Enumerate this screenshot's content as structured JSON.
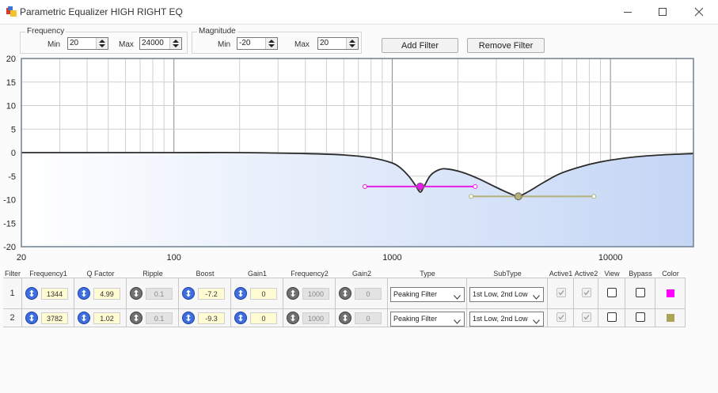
{
  "window": {
    "title": "Parametric Equalizer HIGH RIGHT EQ",
    "controls": [
      "minimize-icon",
      "maximize-icon",
      "close-icon"
    ]
  },
  "frequency_group": {
    "legend": "Frequency",
    "min_label": "Min",
    "min_value": "20",
    "max_label": "Max",
    "max_value": "24000"
  },
  "magnitude_group": {
    "legend": "Magnitude",
    "min_label": "Min",
    "min_value": "-20",
    "max_label": "Max",
    "max_value": "20"
  },
  "buttons": {
    "add_filter": "Add Filter",
    "remove_filter": "Remove Filter"
  },
  "chart_data": {
    "type": "line",
    "title": "",
    "xlabel": "",
    "ylabel": "",
    "x_scale": "log",
    "xlim": [
      20,
      24000
    ],
    "ylim": [
      -20,
      20
    ],
    "x_tick_labels": [
      {
        "value": 20,
        "label": "20"
      },
      {
        "value": 100,
        "label": "100"
      },
      {
        "value": 1000,
        "label": "1000"
      },
      {
        "value": 10000,
        "label": "10000"
      }
    ],
    "y_tick_labels": [
      {
        "value": 20,
        "label": "20"
      },
      {
        "value": 15,
        "label": "15"
      },
      {
        "value": 10,
        "label": "10"
      },
      {
        "value": 5,
        "label": "5"
      },
      {
        "value": 0,
        "label": "0"
      },
      {
        "value": -5,
        "label": "-5"
      },
      {
        "value": -10,
        "label": "-10"
      },
      {
        "value": -15,
        "label": "-15"
      },
      {
        "value": -20,
        "label": "-20"
      }
    ],
    "grid": true,
    "fill_color": "#c4d6f5",
    "series": [
      {
        "color": "#2b2b2b",
        "x": [
          20,
          100,
          200,
          400,
          600,
          800,
          1000,
          1100,
          1200,
          1280,
          1344,
          1400,
          1500,
          1650,
          1800,
          2100,
          2500,
          3000,
          3500,
          3782,
          4200,
          5000,
          6000,
          8000,
          10000,
          13000,
          17000,
          24000
        ],
        "y": [
          0,
          0,
          0,
          -0.2,
          -0.5,
          -1.1,
          -2.2,
          -3.4,
          -5.2,
          -7.0,
          -8.4,
          -7.2,
          -4.8,
          -3.6,
          -3.5,
          -4.2,
          -5.6,
          -7.4,
          -8.8,
          -9.3,
          -8.3,
          -6.2,
          -4.3,
          -2.5,
          -1.6,
          -0.9,
          -0.5,
          -0.2
        ]
      }
    ],
    "filter_markers": [
      {
        "frequency": 1344,
        "gain": -7.2,
        "low": 750,
        "high": 2400,
        "color": "#e81ce8"
      },
      {
        "frequency": 3782,
        "gain": -9.3,
        "low": 2300,
        "high": 8400,
        "color": "#b3b07a"
      }
    ]
  },
  "table": {
    "headers": [
      "Filter",
      "Frequency1",
      "Q Factor",
      "Ripple",
      "Boost",
      "Gain1",
      "Frequency2",
      "Gain2",
      "Type",
      "SubType",
      "Active1",
      "Active2",
      "View",
      "Bypass",
      "Color"
    ],
    "rows": [
      {
        "filter": "1",
        "frequency1": "1344",
        "q_factor": "4.99",
        "ripple": "0.1",
        "boost": "-7.2",
        "gain1": "0",
        "frequency2": "1000",
        "gain2": "0",
        "type": "Peaking Filter",
        "subtype": "1st Low, 2nd Low",
        "active1": true,
        "active2": true,
        "view": false,
        "bypass": false,
        "color": "#ff00ff"
      },
      {
        "filter": "2",
        "frequency1": "3782",
        "q_factor": "1.02",
        "ripple": "0.1",
        "boost": "-9.3",
        "gain1": "0",
        "frequency2": "1000",
        "gain2": "0",
        "type": "Peaking Filter",
        "subtype": "1st Low, 2nd Low",
        "active1": true,
        "active2": true,
        "view": false,
        "bypass": false,
        "color": "#aea35a"
      }
    ]
  }
}
